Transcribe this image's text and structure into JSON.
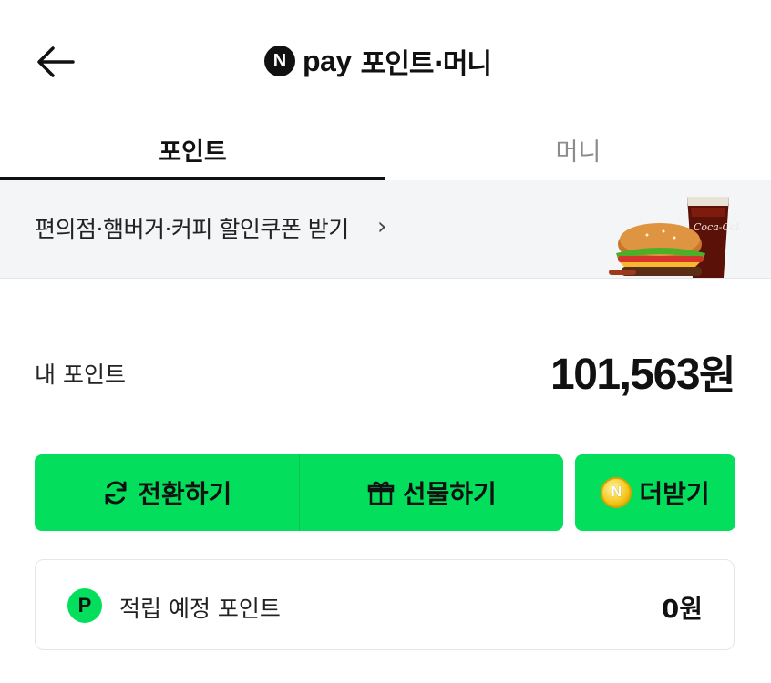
{
  "header": {
    "brand_badge": "N",
    "brand_pay": "pay",
    "title": "포인트·머니"
  },
  "tabs": [
    {
      "label": "포인트",
      "active": true
    },
    {
      "label": "머니",
      "active": false
    }
  ],
  "banner": {
    "text": "편의점·햄버거·커피 할인쿠폰 받기",
    "chevron": "›",
    "image_text": "Coca-Cola"
  },
  "points": {
    "label": "내 포인트",
    "amount": "101,563",
    "unit": "원"
  },
  "actions": {
    "convert_label": "전환하기",
    "gift_label": "선물하기",
    "more_label": "더받기",
    "coin_letter": "N"
  },
  "pending": {
    "icon_letter": "P",
    "label": "적립 예정 포인트",
    "value": "0원"
  },
  "colors": {
    "accent_green": "#03df5c",
    "banner_bg": "#f3f5f7",
    "text_dark": "#111111",
    "tab_inactive": "#8c8c8c"
  }
}
